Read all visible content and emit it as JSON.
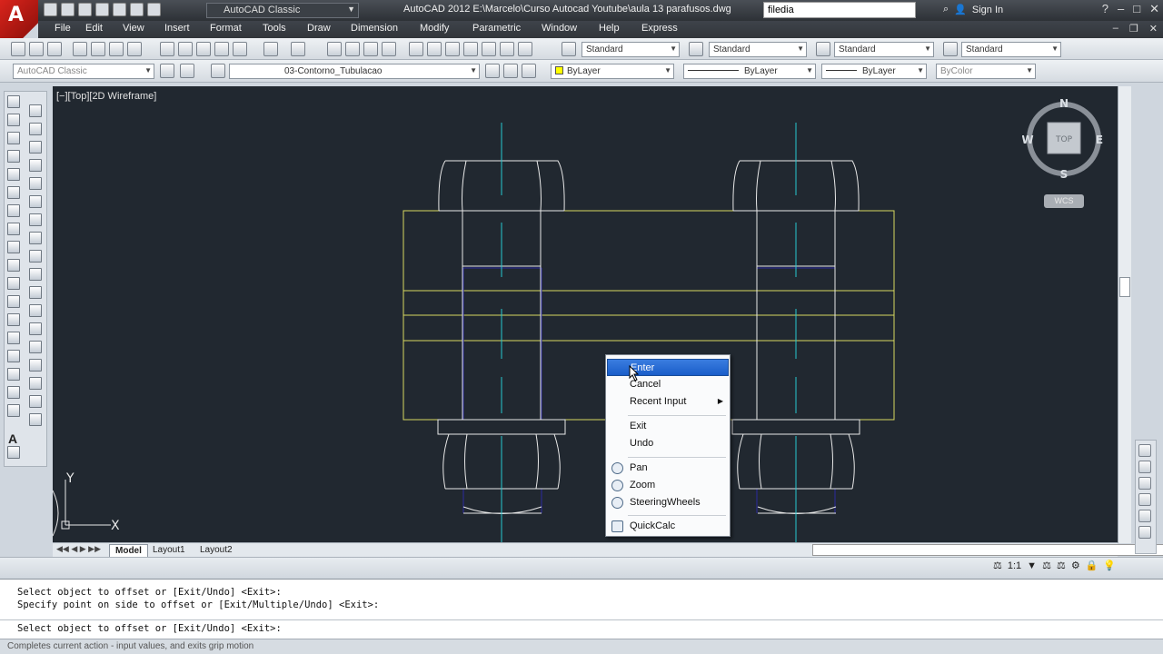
{
  "title_bar": {
    "logo_letter": "A",
    "workspace": "AutoCAD Classic",
    "title": "AutoCAD 2012   E:\\Marcelo\\Curso Autocad Youtube\\aula 13 parafusos.dwg",
    "search_value": "filedia",
    "sign_in": "Sign In"
  },
  "menu": [
    "File",
    "Edit",
    "View",
    "Insert",
    "Format",
    "Tools",
    "Draw",
    "Dimension",
    "Modify",
    "Parametric",
    "Window",
    "Help",
    "Express"
  ],
  "styles_toolbar": {
    "text_style": "Standard",
    "dim_style": "Standard",
    "table_style": "Standard",
    "mleader_style": "Standard"
  },
  "layers_toolbar": {
    "workspace": "AutoCAD Classic",
    "layer": "03-Contorno_Tubulacao",
    "color": "ByLayer",
    "linetype": "ByLayer",
    "lineweight": "ByLayer",
    "plotstyle": "ByColor"
  },
  "viewport": {
    "label": "[−][Top][2D Wireframe]",
    "compass": {
      "n": "N",
      "s": "S",
      "e": "E",
      "w": "W",
      "cube_face": "TOP",
      "ucs": "WCS"
    },
    "ucs_x": "X",
    "ucs_y": "Y"
  },
  "context_menu": {
    "items": [
      {
        "label": "Enter",
        "highlight": true
      },
      {
        "label": "Cancel"
      },
      {
        "label": "Recent Input",
        "submenu": true
      },
      {
        "label": "Exit"
      },
      {
        "label": "Undo"
      },
      {
        "label": "Pan",
        "icon": "pan-icon"
      },
      {
        "label": "Zoom",
        "icon": "zoom-icon"
      },
      {
        "label": "SteeringWheels",
        "icon": "steeringwheels-icon"
      },
      {
        "label": "QuickCalc",
        "icon": "quickcalc-icon"
      }
    ]
  },
  "layout_tabs": [
    "Model",
    "Layout1",
    "Layout2"
  ],
  "annotation_scale": "1:1",
  "command_history": [
    "Select object to offset or [Exit/Undo] <Exit>:",
    "Specify point on side to offset or [Exit/Multiple/Undo] <Exit>:"
  ],
  "command_prompt": "Select object to offset or [Exit/Undo] <Exit>:",
  "status_text": "Completes current action - input values, and exits grip motion",
  "colors": {
    "drawing_yellow": "#d8d860",
    "drawing_white": "#e8e8e8",
    "center_cyan": "#28c8d0",
    "hidden_blue": "#2a2aa0",
    "viewport_bg": "#212830",
    "highlight": "#1f63cf"
  }
}
